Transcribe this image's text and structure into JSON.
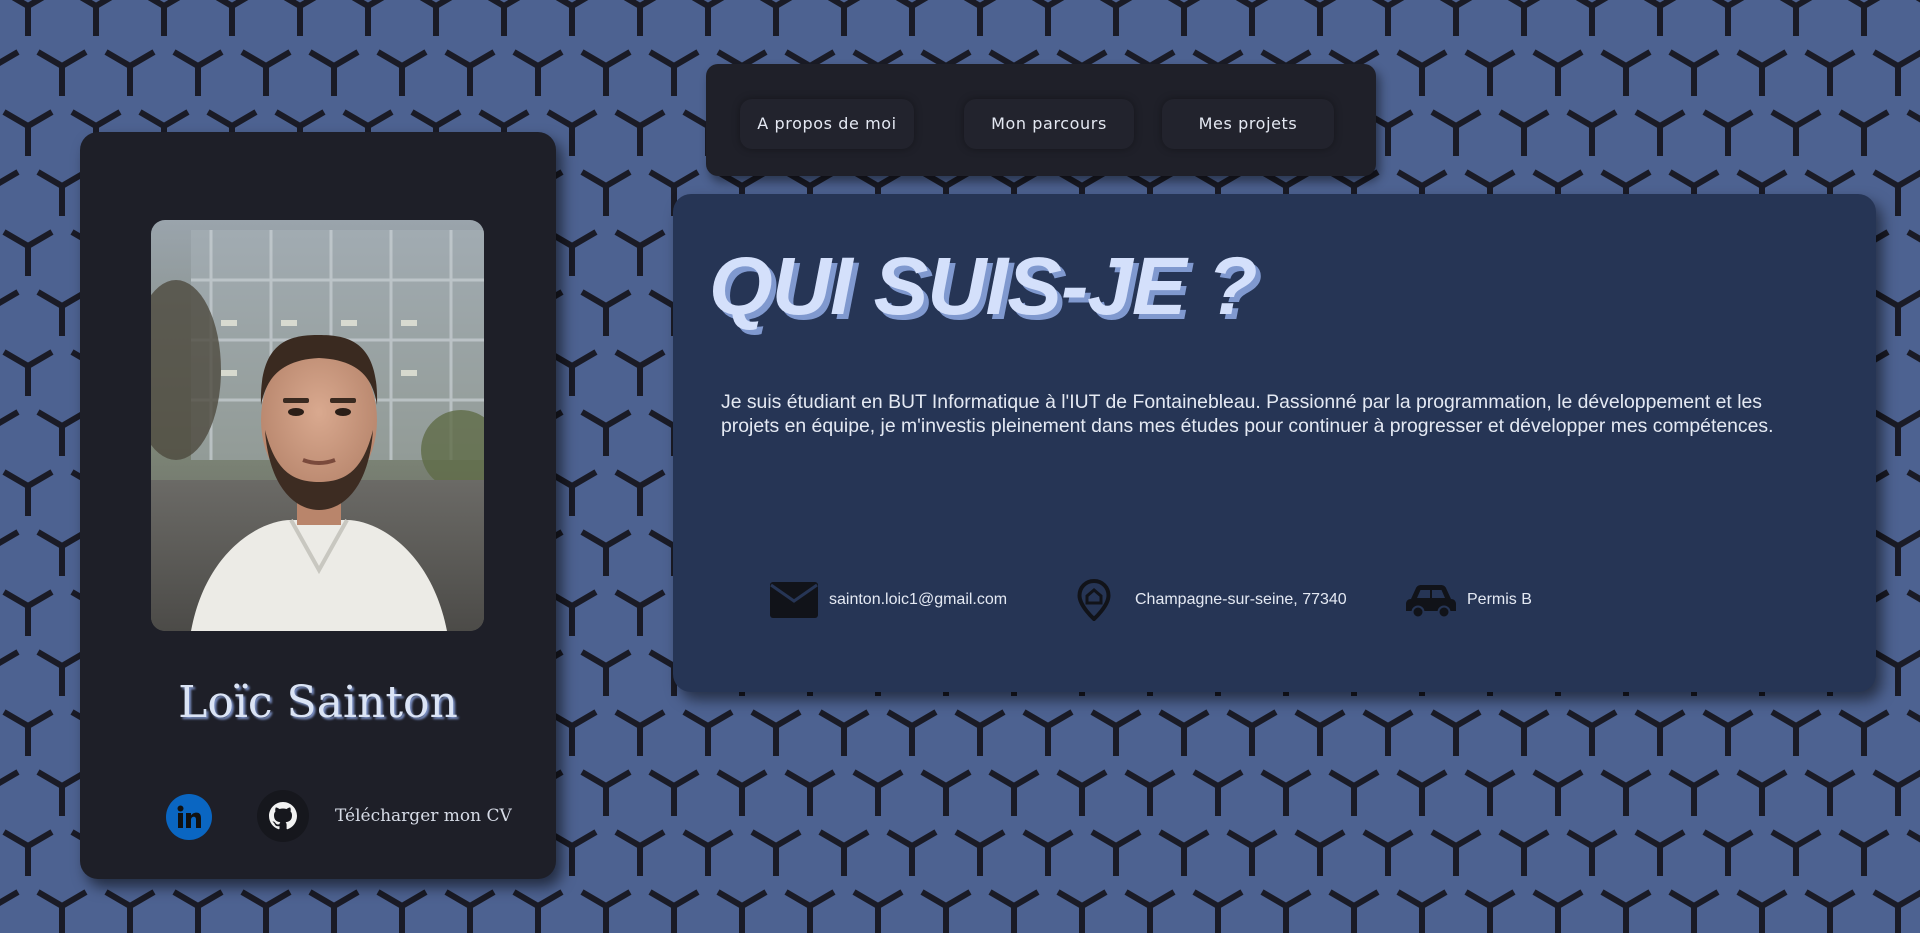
{
  "colors": {
    "background": "#4d6291",
    "pattern": "#1a1b26",
    "card": "#1e1f28",
    "panel": "#263555",
    "title": "#d4e0fb",
    "title_shadow": "#8099cf",
    "linkedin": "#0a66c2"
  },
  "nav": {
    "items": [
      {
        "label": "A propos de moi"
      },
      {
        "label": "Mon parcours"
      },
      {
        "label": "Mes projets"
      }
    ]
  },
  "profile": {
    "name": "Loïc Sainton",
    "photo_alt": "Photo de profil",
    "socials": {
      "linkedin_icon": "linkedin-icon",
      "github_icon": "github-icon",
      "cv_label": "Télécharger mon CV"
    }
  },
  "about": {
    "title": "QUI SUIS-JE ?",
    "text": "Je suis étudiant en BUT Informatique à l'IUT de Fontainebleau. Passionné par la programmation, le développement et les projets en équipe, je m'investis pleinement dans mes études pour continuer à progresser et développer mes compétences.",
    "contacts": [
      {
        "icon": "mail-icon",
        "label": "sainton.loic1@gmail.com"
      },
      {
        "icon": "location-pin-icon",
        "label": "Champagne-sur-seine, 77340"
      },
      {
        "icon": "car-icon",
        "label": "Permis B"
      }
    ]
  }
}
